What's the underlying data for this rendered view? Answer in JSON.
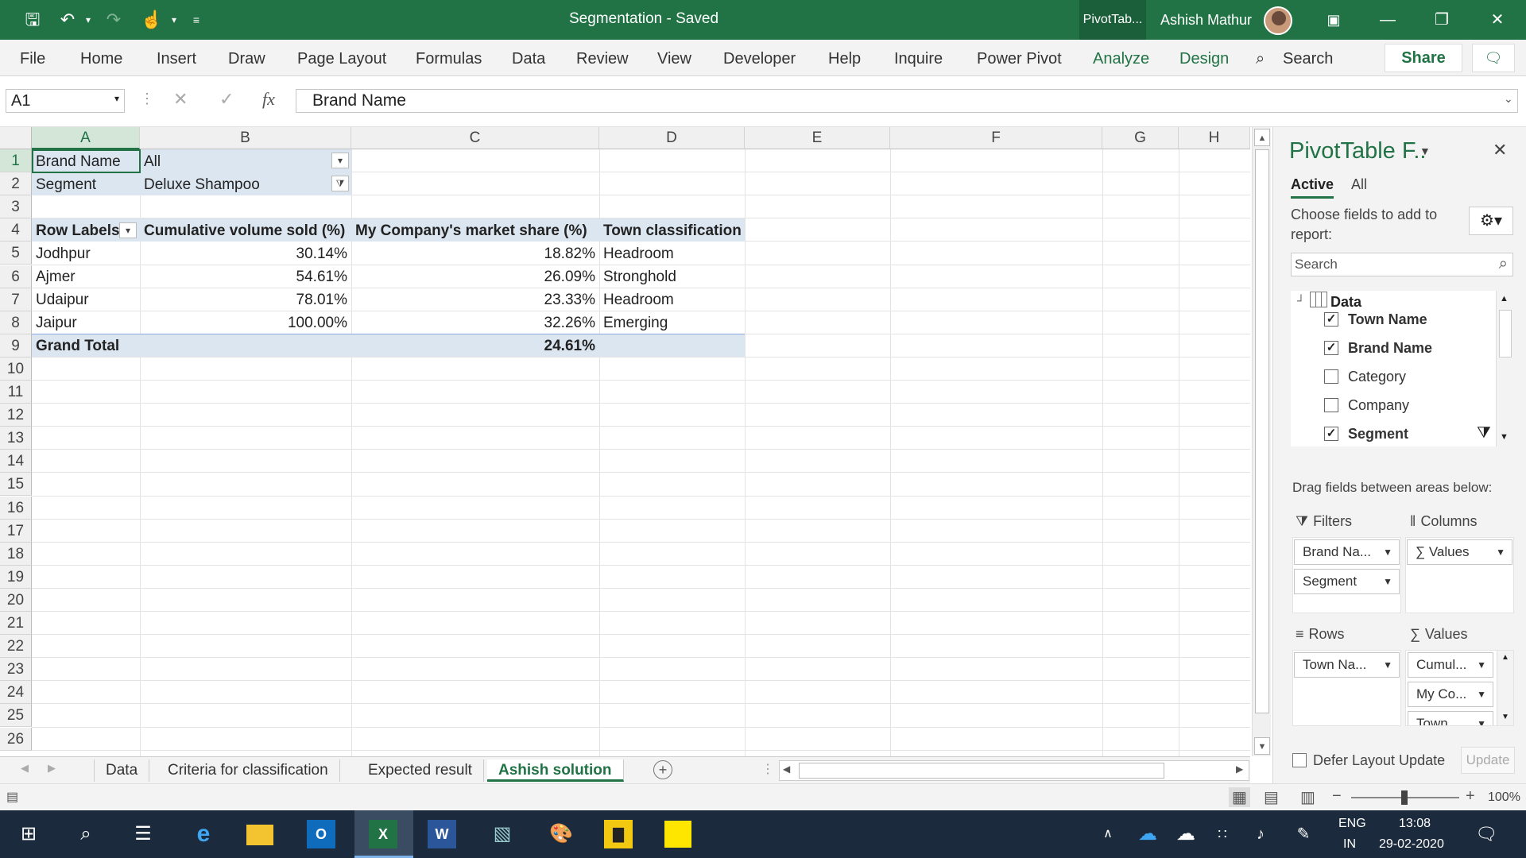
{
  "window": {
    "title": "Segmentation  -  Saved",
    "context_tab": "PivotTab...",
    "user": "Ashish Mathur"
  },
  "ribbon": {
    "tabs": [
      "File",
      "Home",
      "Insert",
      "Draw",
      "Page Layout",
      "Formulas",
      "Data",
      "Review",
      "View",
      "Developer",
      "Help",
      "Inquire",
      "Power Pivot",
      "Analyze",
      "Design"
    ],
    "search": "Search",
    "share": "Share"
  },
  "formula": {
    "namebox": "A1",
    "content": "Brand Name",
    "fx": "fx"
  },
  "columns": [
    "A",
    "B",
    "C",
    "D",
    "E",
    "F",
    "G",
    "H"
  ],
  "rows": [
    "1",
    "2",
    "3",
    "4",
    "5",
    "6",
    "7",
    "8",
    "9",
    "10",
    "11",
    "12",
    "13",
    "14",
    "15",
    "16",
    "17",
    "18",
    "19",
    "20",
    "21",
    "22",
    "23",
    "24",
    "25",
    "26"
  ],
  "pivot": {
    "filters": [
      {
        "label": "Brand Name",
        "value": "All"
      },
      {
        "label": "Segment",
        "value": "Deluxe Shampoo"
      }
    ],
    "headers": [
      "Row Labels",
      "Cumulative volume sold (%)",
      "My Company's market share (%)",
      "Town classification"
    ],
    "rows": [
      {
        "town": "Jodhpur",
        "cum": "30.14%",
        "share": "18.82%",
        "class": "Headroom"
      },
      {
        "town": "Ajmer",
        "cum": "54.61%",
        "share": "26.09%",
        "class": "Stronghold"
      },
      {
        "town": "Udaipur",
        "cum": "78.01%",
        "share": "23.33%",
        "class": "Headroom"
      },
      {
        "town": "Jaipur",
        "cum": "100.00%",
        "share": "32.26%",
        "class": "Emerging"
      }
    ],
    "grand_total": {
      "label": "Grand Total",
      "share": "24.61%"
    }
  },
  "sheet_tabs": [
    "Data",
    "Criteria for classification",
    "Expected result",
    "Ashish solution"
  ],
  "active_tab": "Ashish solution",
  "pane": {
    "title": "PivotTable F..",
    "tab_active": "Active",
    "tab_all": "All",
    "choose": "Choose fields to add to report:",
    "search": "Search",
    "table": "Data",
    "fields": [
      {
        "name": "Town Name",
        "checked": true
      },
      {
        "name": "Brand Name",
        "checked": true
      },
      {
        "name": "Category",
        "checked": false
      },
      {
        "name": "Company",
        "checked": false
      },
      {
        "name": "Segment",
        "checked": true
      }
    ],
    "drag_text": "Drag fields between areas below:",
    "filters_label": "Filters",
    "columns_label": "Columns",
    "rows_label": "Rows",
    "values_label": "Values",
    "filter_chips": [
      "Brand Na...",
      "Segment"
    ],
    "column_chips": [
      "Values"
    ],
    "row_chips": [
      "Town Na..."
    ],
    "value_chips": [
      "Cumul...",
      "My Co...",
      "Town..."
    ],
    "defer": "Defer Layout Update",
    "update": "Update"
  },
  "statusbar": {
    "zoom": "100%"
  },
  "taskbar": {
    "lang1": "ENG",
    "lang2": "IN",
    "time": "13:08",
    "date": "29-02-2020"
  },
  "colors": {
    "excel_green": "#217346",
    "pivot_fill": "#dce6f1"
  }
}
